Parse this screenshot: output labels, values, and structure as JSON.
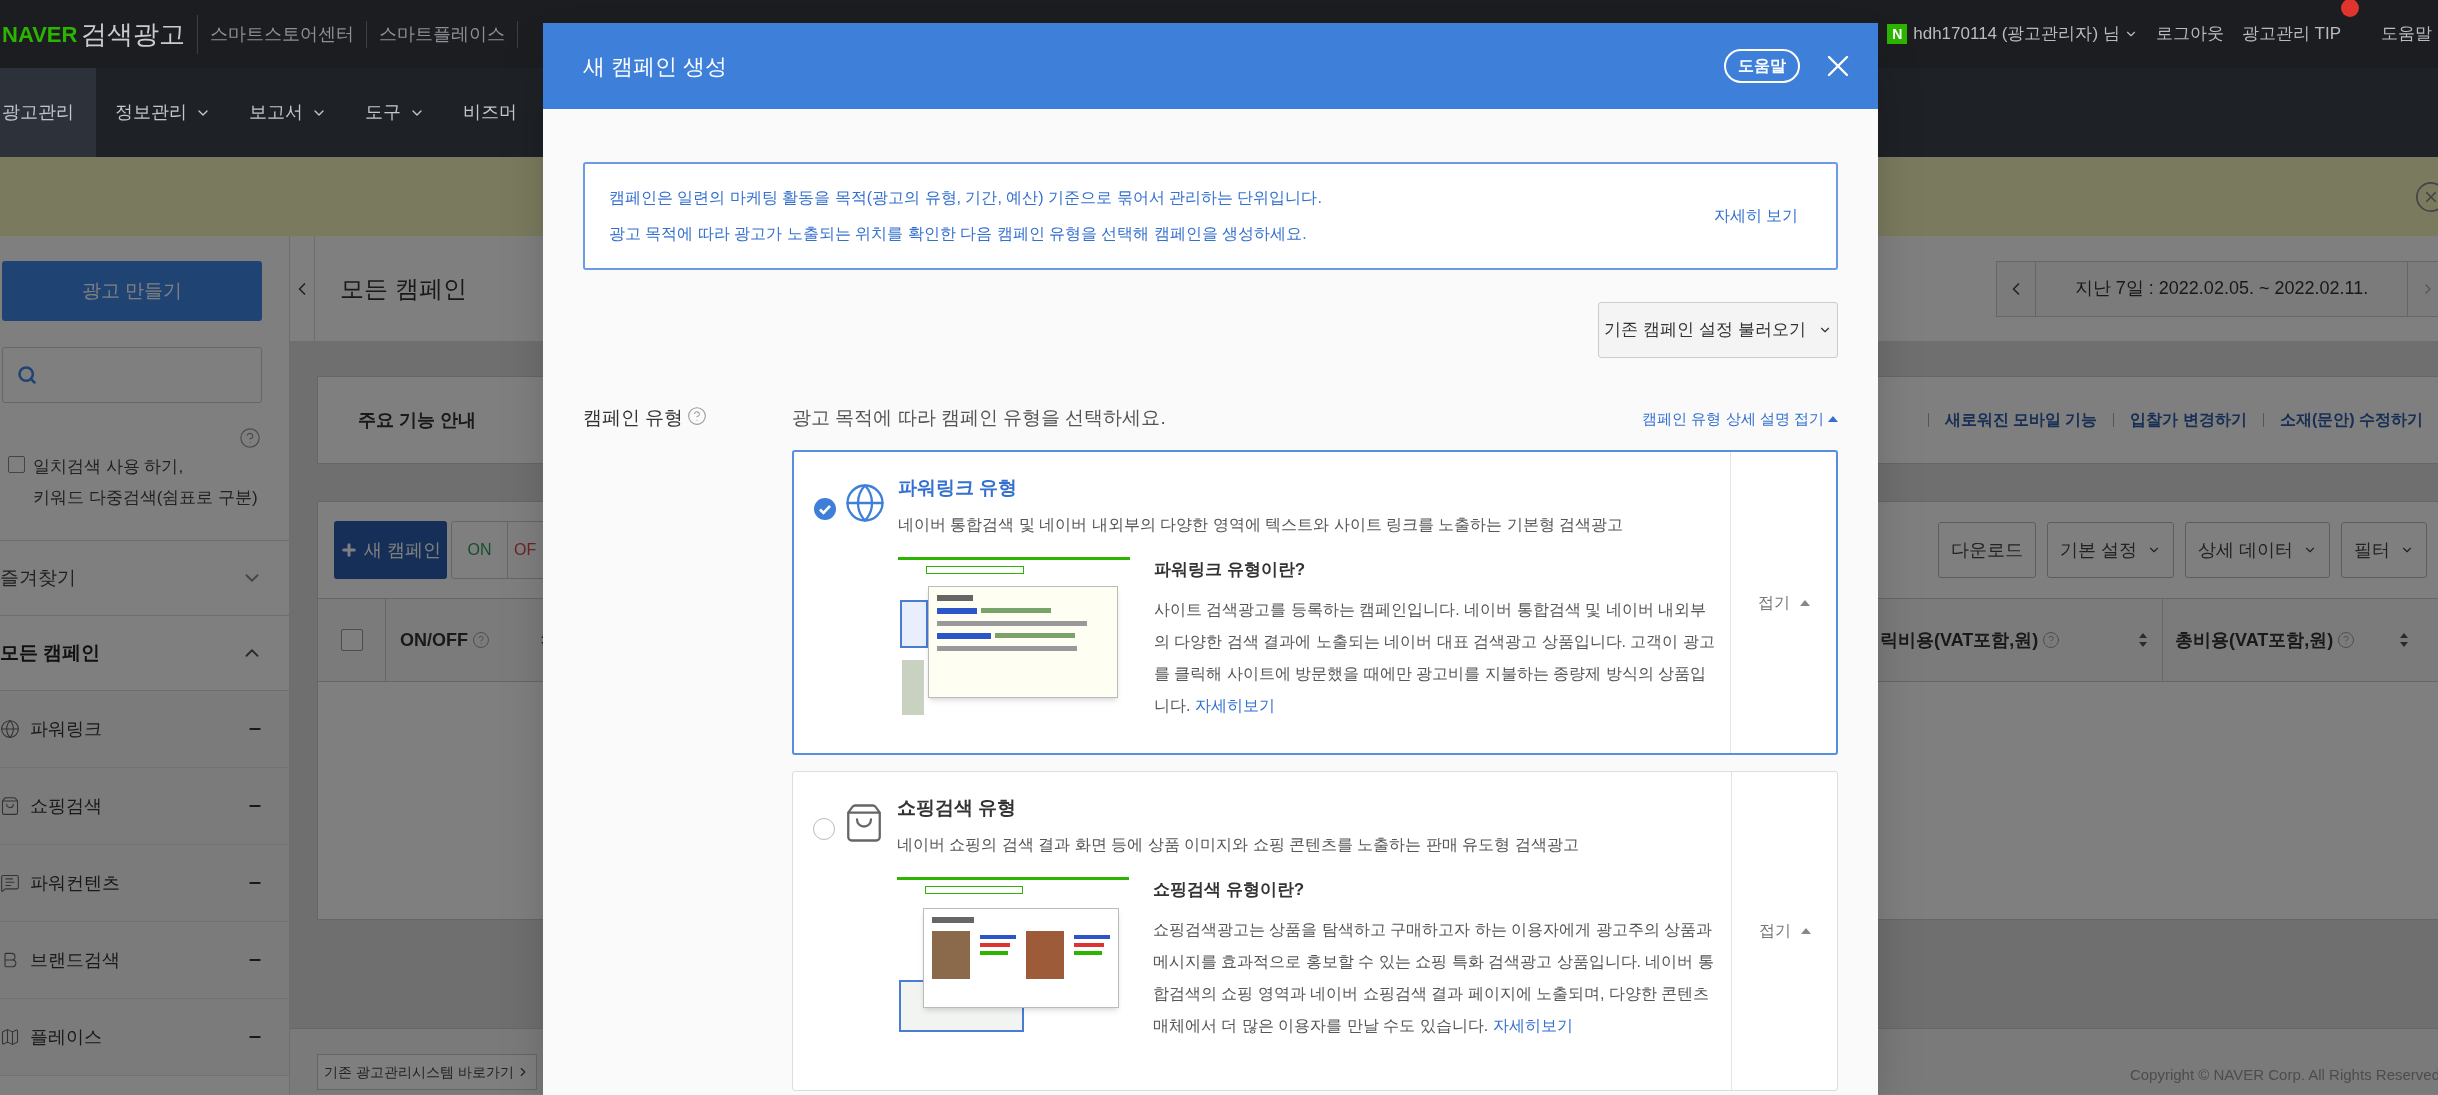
{
  "top_bar": {
    "brand": "NAVER",
    "product": "검색광고",
    "links": [
      "스마트스토어센터",
      "스마트플레이스"
    ],
    "user_badge": "N",
    "user": "hdh170114 (광고관리자) 님",
    "logout": "로그아웃",
    "tip": "광고관리 TIP",
    "help": "도움말"
  },
  "nav": [
    {
      "label": "광고관리",
      "selected": true,
      "dropdown": false
    },
    {
      "label": "정보관리",
      "selected": false,
      "dropdown": true
    },
    {
      "label": "보고서",
      "selected": false,
      "dropdown": true
    },
    {
      "label": "도구",
      "selected": false,
      "dropdown": true
    },
    {
      "label": "비즈머",
      "selected": false,
      "dropdown": false
    }
  ],
  "sidebar": {
    "create_button": "광고 만들기",
    "exact_match": {
      "checked": false,
      "label": "일치검색 사용 하기,\n키워드 다중검색(쉼표로 구분)"
    },
    "sections": [
      {
        "label": "즐겨찾기",
        "selected": false,
        "expanded": false
      },
      {
        "label": "모든 캠페인",
        "selected": true,
        "expanded": true
      }
    ],
    "items": [
      {
        "kind": "globe",
        "label": "파워링크"
      },
      {
        "kind": "bag",
        "label": "쇼핑검색"
      },
      {
        "kind": "chat",
        "label": "파워컨텐츠"
      },
      {
        "kind": "brand",
        "label": "브랜드검색"
      },
      {
        "kind": "map",
        "label": "플레이스"
      }
    ]
  },
  "content": {
    "title": "모든 캠페인",
    "date_range": "지난 7일 : 2022.02.05. ~ 2022.02.11.",
    "features": {
      "title": "주요 기능 안내",
      "links": [
        "새로워진 모바일 기능",
        "입찰가 변경하기",
        "소재(문안) 수정하기"
      ]
    },
    "new_campaign": "새 캠페인",
    "toggles": [
      {
        "kind": "on",
        "label": "ON"
      },
      {
        "kind": "off",
        "label": "OF"
      }
    ],
    "tools": [
      {
        "label": "다운로드",
        "dropdown": false
      },
      {
        "label": "기본 설정",
        "dropdown": true
      },
      {
        "label": "상세 데이터",
        "dropdown": true
      },
      {
        "label": "필터",
        "dropdown": true
      }
    ],
    "select_all": {
      "checked": false
    },
    "columns": [
      {
        "label": "ON/OFF"
      },
      {
        "label": "릭비용(VAT포함,원)"
      },
      {
        "label": "총비용(VAT포함,원)"
      }
    ],
    "legacy_link": "기존 광고관리시스템 바로가기",
    "copyright": "Copyright © NAVER Corp. All Rights Reserved"
  },
  "modal": {
    "title": "새 캠페인 생성",
    "help": "도움말",
    "info": [
      "캠페인은 일련의 마케팅 활동을 목적(광고의 유형, 기간, 예산) 기준으로 묶어서 관리하는 단위입니다.",
      "광고 목적에 따라 광고가 노출되는 위치를 확인한 다음 캠페인 유형을 선택해 캠페인을 생성하세요."
    ],
    "info_link": "자세히 보기",
    "load_settings": "기존 캠페인 설정 불러오기",
    "type_label": "캠페인 유형",
    "prompt": "광고 목적에 따라 캠페인 유형을 선택하세요.",
    "collapse_all": "캠페인 유형 상세 설명 접기",
    "options": [
      {
        "kind": "globe",
        "selected": true,
        "title": "파워링크 유형",
        "description": "네이버 통합검색 및 네이버 내외부의 다양한 영역에 텍스트와 사이트 링크를 노출하는 기본형 검색광고",
        "detail_title": "파워링크 유형이란?",
        "detail": "사이트 검색광고를 등록하는 캠페인입니다. 네이버 통합검색 및 네이버 내외부의 다양한 검색 결과에 노출되는 네이버 대표 검색광고 상품입니다. 고객이 광고를 클릭해 사이트에 방문했을 때에만 광고비를 지불하는 종량제 방식의 상품입니다.",
        "more": "자세히보기",
        "collapse": "접기"
      },
      {
        "kind": "bag",
        "selected": false,
        "title": "쇼핑검색 유형",
        "description": "네이버 쇼핑의 검색 결과 화면 등에 상품 이미지와 쇼핑 콘텐츠를 노출하는 판매 유도형 검색광고",
        "detail_title": "쇼핑검색 유형이란?",
        "detail": "쇼핑검색광고는 상품을 탐색하고 구매하고자 하는 이용자에게 광고주의 상품과 메시지를 효과적으로 홍보할 수 있는 쇼핑 특화 검색광고 상품입니다. 네이버 통합검색의 쇼핑 영역과 네이버 쇼핑검색 결과 페이지에 노출되며, 다양한 콘텐츠 매체에서 더 많은 이용자를 만날 수도 있습니다.",
        "more": "자세히보기",
        "collapse": "접기"
      }
    ]
  }
}
